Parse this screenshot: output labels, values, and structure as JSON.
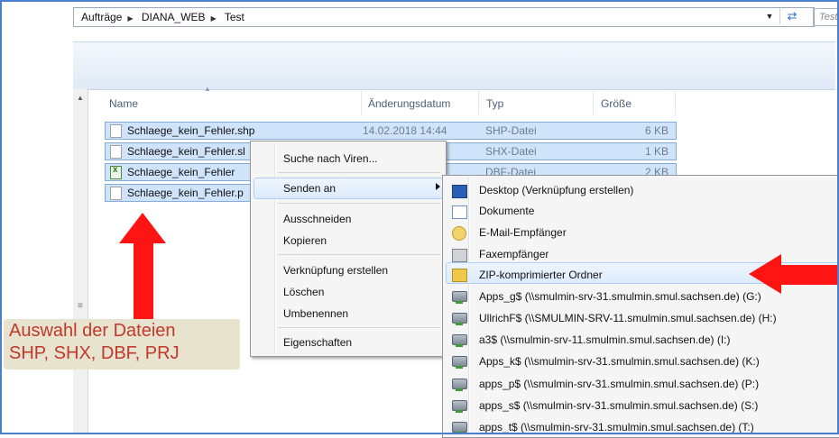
{
  "address_bar": {
    "crumbs": [
      "Aufträge",
      "DIANA_WEB",
      "Test"
    ],
    "search_placeholder": "Test"
  },
  "columns": {
    "name": "Name",
    "date": "Änderungsdatum",
    "type": "Typ",
    "size": "Größe"
  },
  "files": [
    {
      "name": "Schlaege_kein_Fehler.shp",
      "date": "14.02.2018 14:44",
      "type": "SHP-Datei",
      "size": "6 KB",
      "icon": "file-icon"
    },
    {
      "name": "Schlaege_kein_Fehler.sl",
      "date": "",
      "type": "SHX-Datei",
      "size": "1 KB",
      "icon": "file-icon"
    },
    {
      "name": "Schlaege_kein_Fehler",
      "date": "",
      "type": "DBF-Datei",
      "size": "2 KB",
      "icon": "excel-file-icon"
    },
    {
      "name": "Schlaege_kein_Fehler.p",
      "date": "",
      "type": "",
      "size": "",
      "icon": "file-icon"
    }
  ],
  "context_menu": {
    "items": [
      "Suche nach Viren...",
      "Senden an",
      "Ausschneiden",
      "Kopieren",
      "Verknüpfung erstellen",
      "Löschen",
      "Umbenennen",
      "Eigenschaften"
    ],
    "highlighted": "Senden an"
  },
  "send_to_menu": {
    "items": [
      {
        "label": "Desktop (Verknüpfung erstellen)",
        "icon": "desktop-icon"
      },
      {
        "label": "Dokumente",
        "icon": "documents-icon"
      },
      {
        "label": "E-Mail-Empfänger",
        "icon": "mail-icon"
      },
      {
        "label": "Faxempfänger",
        "icon": "fax-icon"
      },
      {
        "label": "ZIP-komprimierter Ordner",
        "icon": "zip-folder-icon"
      },
      {
        "label": "Apps_g$ (\\\\smulmin-srv-31.smulmin.smul.sachsen.de) (G:)",
        "icon": "network-drive-icon"
      },
      {
        "label": "UllrichF$ (\\\\SMULMIN-SRV-11.smulmin.smul.sachsen.de) (H:)",
        "icon": "network-drive-icon"
      },
      {
        "label": "a3$ (\\\\smulmin-srv-11.smulmin.smul.sachsen.de) (I:)",
        "icon": "network-drive-icon"
      },
      {
        "label": "Apps_k$ (\\\\smulmin-srv-31.smulmin.smul.sachsen.de) (K:)",
        "icon": "network-drive-icon"
      },
      {
        "label": "apps_p$ (\\\\smulmin-srv-31.smulmin.smul.sachsen.de) (P:)",
        "icon": "network-drive-icon"
      },
      {
        "label": "apps_s$ (\\\\smulmin-srv-31.smulmin.smul.sachsen.de) (S:)",
        "icon": "network-drive-icon"
      },
      {
        "label": "apps_t$ (\\\\smulmin-srv-31.smulmin.smul.sachsen.de) (T:)",
        "icon": "network-drive-icon"
      }
    ],
    "highlighted": "ZIP-komprimierter Ordner"
  },
  "annotation": {
    "line1": "Auswahl der Dateien",
    "line2": "SHP, SHX, DBF, PRJ",
    "color": "#ff1414"
  }
}
